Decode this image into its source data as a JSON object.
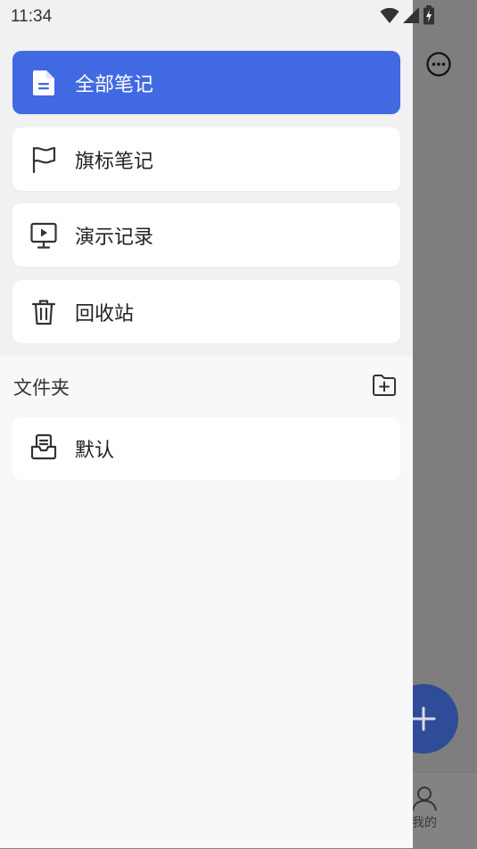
{
  "status_bar": {
    "time": "11:34"
  },
  "drawer": {
    "nav_items": [
      {
        "label": "全部笔记",
        "icon": "document-icon",
        "active": true
      },
      {
        "label": "旗标笔记",
        "icon": "flag-icon",
        "active": false
      },
      {
        "label": "演示记录",
        "icon": "presentation-icon",
        "active": false
      },
      {
        "label": "回收站",
        "icon": "trash-icon",
        "active": false
      }
    ],
    "folders_section": {
      "title": "文件夹",
      "add_icon": "folder-add-icon",
      "folders": [
        {
          "label": "默认",
          "icon": "inbox-icon"
        }
      ]
    }
  },
  "background": {
    "bottom_tab_mine": "我的"
  },
  "colors": {
    "accent": "#4169e1",
    "drawer_bg": "#f8f8fb",
    "scrim": "#7e7e7e"
  }
}
